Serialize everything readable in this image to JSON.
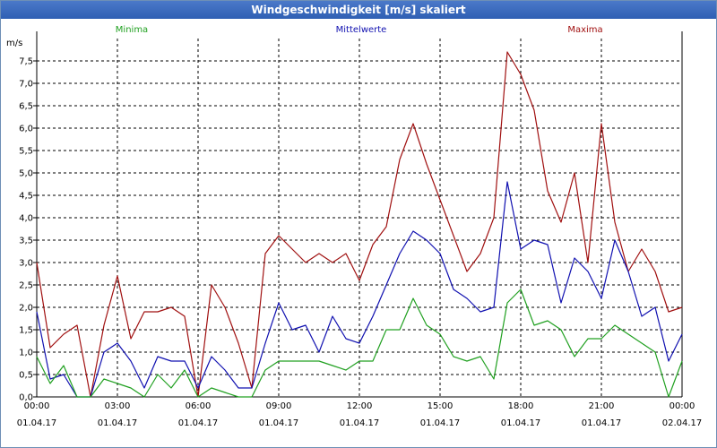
{
  "window": {
    "title": "Windgeschwindigkeit [m/s] skaliert"
  },
  "colors": {
    "minima": "#20a020",
    "mittelwerte": "#1010b0",
    "maxima": "#a01010",
    "grid": "#000000",
    "titlebar": "#3264b9"
  },
  "chart_data": {
    "type": "line",
    "title": "Windgeschwindigkeit [m/s] skaliert",
    "ylabel": "m/s",
    "xlabel": "",
    "ylim": [
      0,
      8
    ],
    "xlim": [
      0,
      24
    ],
    "grid": true,
    "legend_placement": "top",
    "y_ticks": [
      "0,0",
      "0,5",
      "1,0",
      "1,5",
      "2,0",
      "2,5",
      "3,0",
      "3,5",
      "4,0",
      "4,5",
      "5,0",
      "5,5",
      "6,0",
      "6,5",
      "7,0",
      "7,5"
    ],
    "x_ticks": [
      {
        "time": "00:00",
        "date": "01.04.17"
      },
      {
        "time": "03:00",
        "date": "01.04.17"
      },
      {
        "time": "06:00",
        "date": "01.04.17"
      },
      {
        "time": "09:00",
        "date": "01.04.17"
      },
      {
        "time": "12:00",
        "date": "01.04.17"
      },
      {
        "time": "15:00",
        "date": "01.04.17"
      },
      {
        "time": "18:00",
        "date": "01.04.17"
      },
      {
        "time": "21:00",
        "date": "01.04.17"
      },
      {
        "time": "00:00",
        "date": "02.04.17"
      }
    ],
    "x_hours": [
      0,
      0.5,
      1,
      1.5,
      2,
      2.5,
      3,
      3.5,
      4,
      4.5,
      5,
      5.5,
      6,
      6.5,
      7,
      7.5,
      8,
      8.5,
      9,
      9.5,
      10,
      10.5,
      11,
      11.5,
      12,
      12.5,
      13,
      13.5,
      14,
      14.5,
      15,
      15.5,
      16,
      16.5,
      17,
      17.5,
      18,
      18.5,
      19,
      19.5,
      20,
      20.5,
      21,
      21.5,
      22,
      22.5,
      23,
      23.5,
      24
    ],
    "series": [
      {
        "name": "Minima",
        "values": [
          0.9,
          0.3,
          0.7,
          0.0,
          0.0,
          0.4,
          0.3,
          0.2,
          0.0,
          0.5,
          0.2,
          0.6,
          0.0,
          0.2,
          0.1,
          0.0,
          0.0,
          0.6,
          0.8,
          0.8,
          0.8,
          0.8,
          0.7,
          0.6,
          0.8,
          0.8,
          1.5,
          1.5,
          2.2,
          1.6,
          1.4,
          0.9,
          0.8,
          0.9,
          0.4,
          2.1,
          2.4,
          1.6,
          1.7,
          1.5,
          0.9,
          1.3,
          1.3,
          1.6,
          1.4,
          1.2,
          1.0,
          0.0,
          0.8
        ]
      },
      {
        "name": "Mittelwerte",
        "values": [
          1.9,
          0.4,
          0.5,
          0.0,
          0.0,
          1.0,
          1.2,
          0.8,
          0.2,
          0.9,
          0.8,
          0.8,
          0.2,
          0.9,
          0.6,
          0.2,
          0.2,
          1.2,
          2.1,
          1.5,
          1.6,
          1.0,
          1.8,
          1.3,
          1.2,
          1.8,
          2.5,
          3.2,
          3.7,
          3.5,
          3.2,
          2.4,
          2.2,
          1.9,
          2.0,
          4.8,
          3.3,
          3.5,
          3.4,
          2.1,
          3.1,
          2.8,
          2.2,
          3.5,
          2.8,
          1.8,
          2.0,
          0.8,
          1.4
        ]
      },
      {
        "name": "Maxima",
        "values": [
          3.0,
          1.1,
          1.4,
          1.6,
          0.0,
          1.6,
          2.7,
          1.3,
          1.9,
          1.9,
          2.0,
          1.8,
          0.0,
          2.5,
          2.0,
          1.2,
          0.2,
          3.2,
          3.6,
          3.3,
          3.0,
          3.2,
          3.0,
          3.2,
          2.6,
          3.4,
          3.8,
          5.3,
          6.1,
          5.2,
          4.4,
          3.6,
          2.8,
          3.2,
          4.0,
          7.7,
          7.2,
          6.4,
          4.6,
          3.9,
          5.0,
          3.0,
          6.1,
          3.9,
          2.8,
          3.3,
          2.8,
          1.9,
          2.0
        ]
      }
    ]
  }
}
